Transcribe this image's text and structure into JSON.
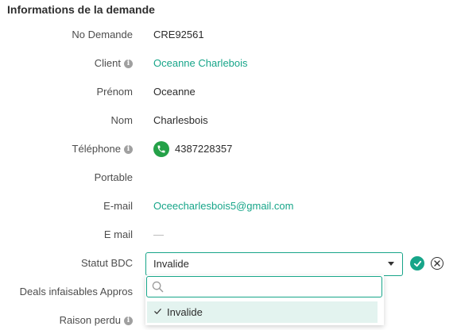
{
  "section": {
    "title": "Informations de la demande"
  },
  "fields": {
    "no_demande": {
      "label": "No Demande",
      "value": "CRE92561"
    },
    "client": {
      "label": "Client",
      "value": "Oceanne Charlebois"
    },
    "prenom": {
      "label": "Prénom",
      "value": "Oceanne"
    },
    "nom": {
      "label": "Nom",
      "value": "Charlesbois"
    },
    "telephone": {
      "label": "Téléphone",
      "value": "4387228357"
    },
    "portable": {
      "label": "Portable",
      "value": ""
    },
    "email1": {
      "label": "E-mail",
      "value": "Oceecharlesbois5@gmail.com"
    },
    "email2": {
      "label": "E mail",
      "value": "—"
    },
    "statut_bdc": {
      "label": "Statut BDC",
      "value": "Invalide"
    },
    "deals": {
      "label": "Deals infaisables Appros"
    },
    "raison_perdu": {
      "label": "Raison perdu"
    }
  },
  "dropdown": {
    "search_placeholder": "",
    "options": [
      {
        "label": "Invalide",
        "selected": true
      }
    ]
  },
  "colors": {
    "accent": "#17a589",
    "phone": "#24a148",
    "selected_bg": "#e3f3ef"
  },
  "icons": [
    "info-icon",
    "phone-icon",
    "caret-down-icon",
    "confirm-check-icon",
    "cancel-x-icon",
    "search-icon",
    "checkmark-icon"
  ]
}
